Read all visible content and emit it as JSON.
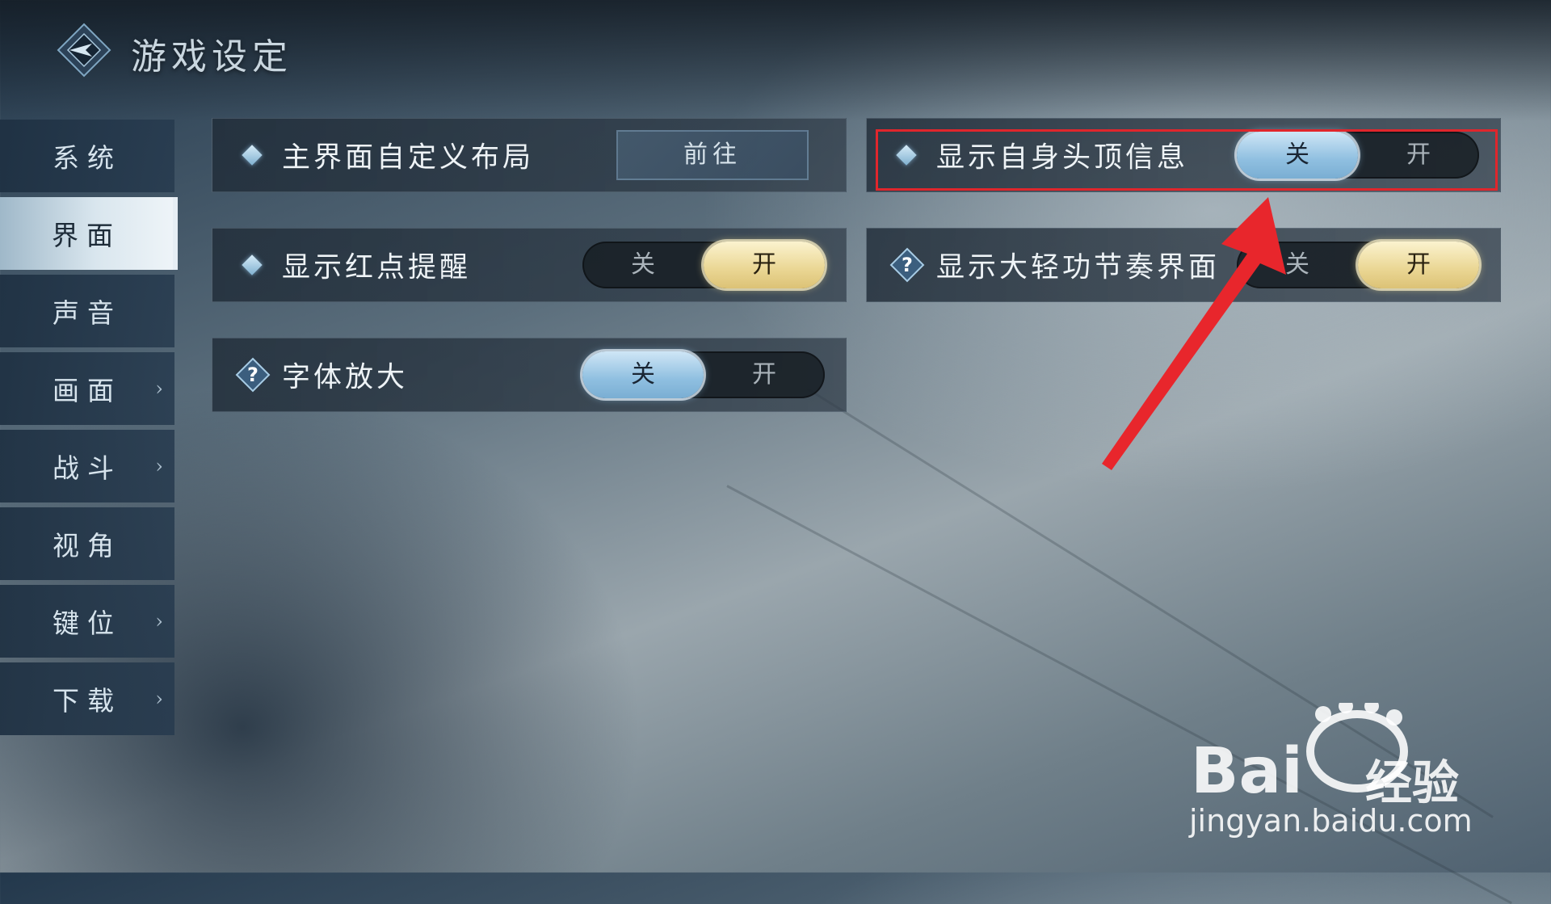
{
  "header": {
    "title": "游戏设定",
    "logo_icon": "game-logo-icon"
  },
  "sidebar": {
    "items": [
      {
        "label": "系统",
        "has_arrow": false,
        "active": false
      },
      {
        "label": "界面",
        "has_arrow": false,
        "active": true
      },
      {
        "label": "声音",
        "has_arrow": false,
        "active": false
      },
      {
        "label": "画面",
        "has_arrow": true,
        "active": false
      },
      {
        "label": "战斗",
        "has_arrow": true,
        "active": false
      },
      {
        "label": "视角",
        "has_arrow": false,
        "active": false
      },
      {
        "label": "键位",
        "has_arrow": true,
        "active": false
      },
      {
        "label": "下载",
        "has_arrow": true,
        "active": false
      }
    ],
    "arrow_glyph": "›"
  },
  "settings": {
    "custom_layout": {
      "label": "主界面自定义布局",
      "button": "前往",
      "icon": "diamond-icon"
    },
    "self_head_info": {
      "label": "显示自身头顶信息",
      "off": "关",
      "on": "开",
      "value": "关",
      "icon": "diamond-icon"
    },
    "red_dot": {
      "label": "显示红点提醒",
      "off": "关",
      "on": "开",
      "value": "开",
      "icon": "diamond-icon"
    },
    "qinggong_rhythm": {
      "label": "显示大轻功节奏界面",
      "off": "关",
      "on": "开",
      "value": "开",
      "icon": "help-icon"
    },
    "font_enlarge": {
      "label": "字体放大",
      "off": "关",
      "on": "开",
      "value": "关",
      "icon": "help-icon"
    }
  },
  "colors": {
    "accent_blue": "#8fbfe0",
    "accent_gold": "#ead693",
    "highlight_red": "#e0262c",
    "arrow_red": "#e8262c"
  },
  "watermark": {
    "brand": "Bai",
    "brand_suffix": "经验",
    "url": "jingyan.baidu.com"
  }
}
